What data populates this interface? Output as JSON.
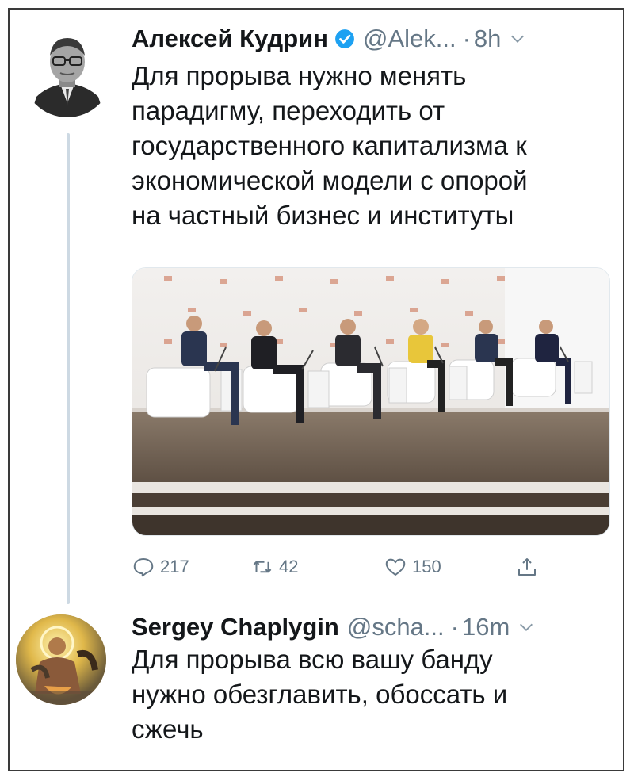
{
  "tweets": [
    {
      "name": "Алексей Кудрин",
      "handle": "@Alek...",
      "separator": "·",
      "time": "8h",
      "text": "Для прорыва нужно менять\nпарадигму, переходить от\nгосударственного капитализма к\nэкономической модели с опорой\nна частный бизнес и институты",
      "verified": true,
      "actions": {
        "replies": "217",
        "retweets": "42",
        "likes": "150"
      }
    },
    {
      "name": "Sergey Chaplygin",
      "handle": "@scha...",
      "separator": "·",
      "time": "16m",
      "text": "Для прорыва всю вашу банду\nнужно обезглавить, обоссать и\nсжечь"
    }
  ],
  "colors": {
    "text": "#14171a",
    "secondary": "#657786",
    "verified": "#1da1f2",
    "thread_line": "#cdd9e3"
  },
  "icons": [
    "verified-badge-icon",
    "chevron-down-icon",
    "reply-icon",
    "retweet-icon",
    "like-icon",
    "share-icon"
  ]
}
